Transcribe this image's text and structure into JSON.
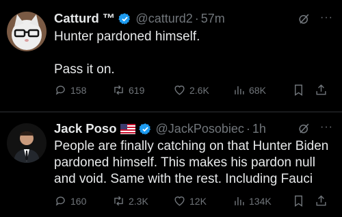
{
  "tweets": [
    {
      "name": "Catturd ™",
      "handle": "@catturd2",
      "time": "57m",
      "text": "Hunter pardoned himself.\n\nPass it on.",
      "reply_count": "158",
      "retweet_count": "619",
      "like_count": "2.6K",
      "view_count": "68K",
      "verified_color": "#1d9bf0"
    },
    {
      "name": "Jack Poso",
      "flag": "us-flag-icon",
      "handle": "@JackPosobiec",
      "time": "1h",
      "text": "People are finally catching on that Hunter Biden pardoned himself. This makes his pardon null and void. Same with the rest. Including Fauci",
      "reply_count": "160",
      "retweet_count": "2.3K",
      "like_count": "12K",
      "view_count": "134K",
      "verified_color": "#1d9bf0"
    }
  ],
  "separator": "·",
  "colors": {
    "background": "#000000",
    "text": "#e7e9ea",
    "muted": "#71767b",
    "divider": "#2f3336"
  }
}
